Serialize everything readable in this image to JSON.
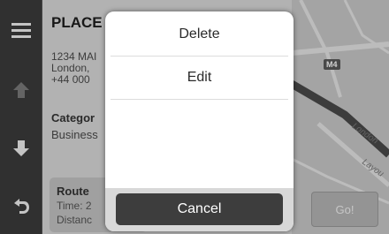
{
  "detail": {
    "title": "PLACE",
    "address_lines": [
      "1234 MAI",
      "London,",
      "+44 000"
    ],
    "category_label": "Categor",
    "category_value": "Business",
    "route": {
      "title": "Route",
      "time": "Time: 2",
      "distance": "Distanc"
    }
  },
  "map": {
    "road_badge": "M4",
    "street_label": "London",
    "street_label_2": "Layou",
    "go_label": "Go!"
  },
  "dialog": {
    "items": [
      {
        "label": "Delete"
      },
      {
        "label": "Edit"
      }
    ],
    "cancel_label": "Cancel"
  },
  "nav": {
    "icons": [
      "menu-icon",
      "arrow-up-icon",
      "arrow-down-icon",
      "back-icon"
    ]
  }
}
